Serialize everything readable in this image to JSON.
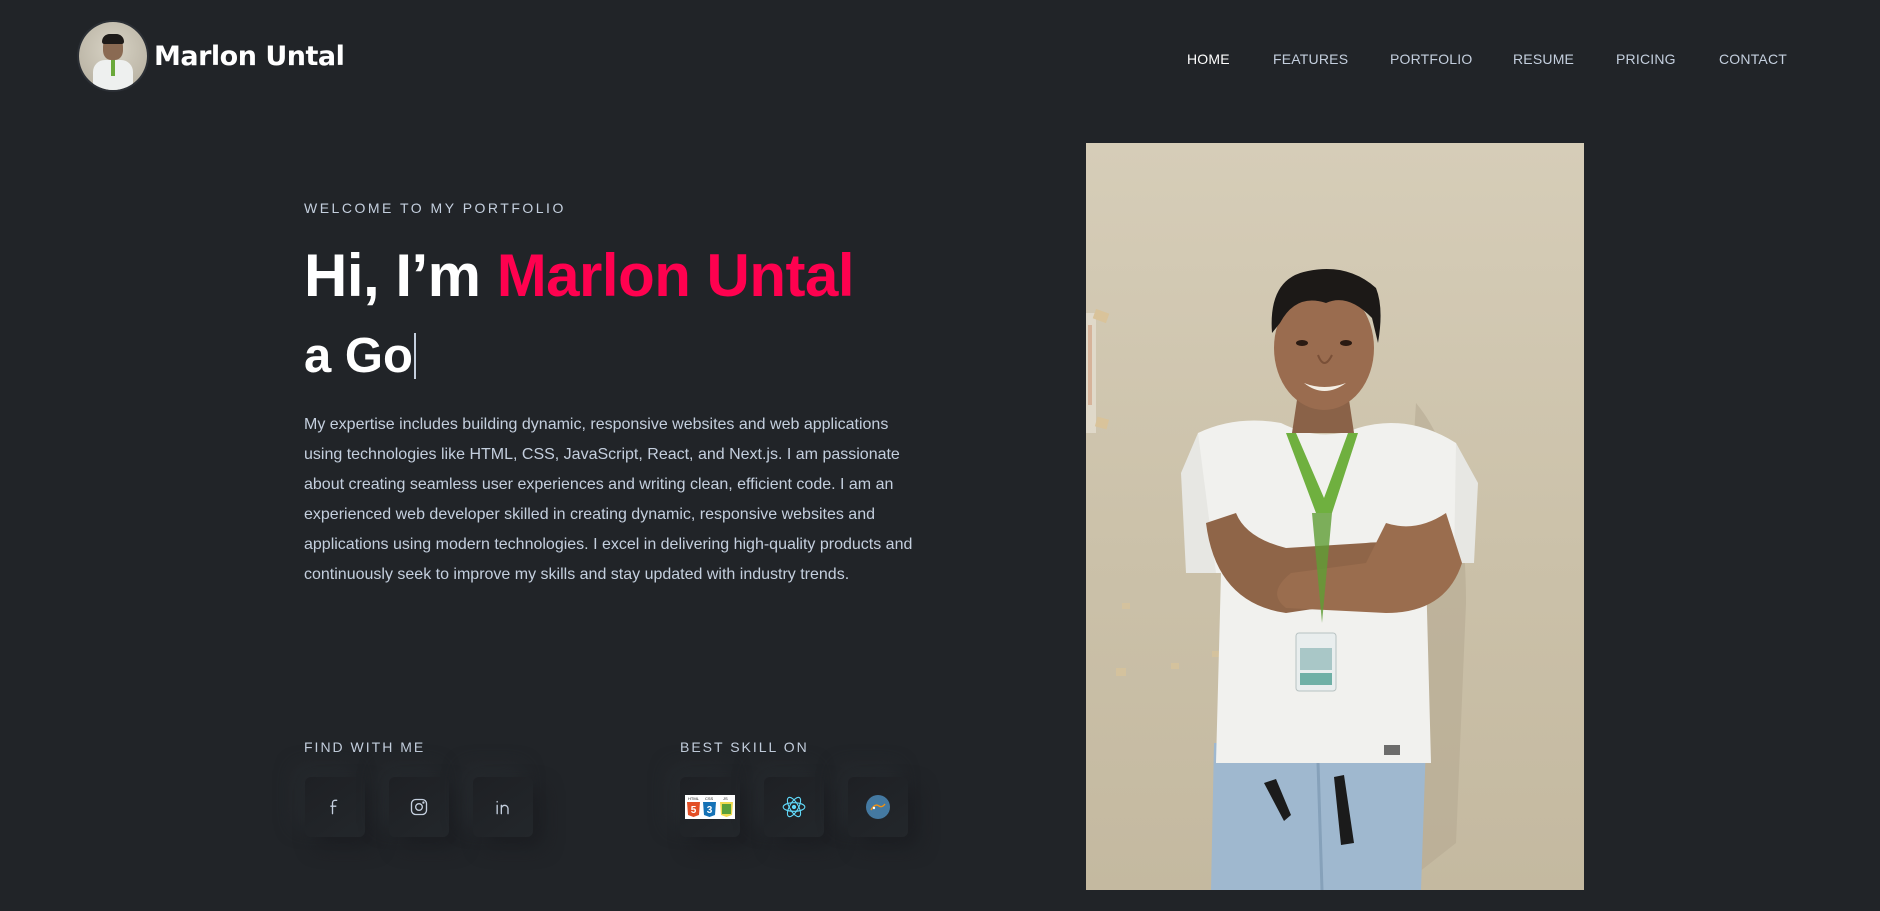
{
  "brand": {
    "name": "Marlon Untal"
  },
  "nav": {
    "items": [
      {
        "label": "HOME",
        "active": true
      },
      {
        "label": "FEATURES",
        "active": false
      },
      {
        "label": "PORTFOLIO",
        "active": false
      },
      {
        "label": "RESUME",
        "active": false
      },
      {
        "label": "PRICING",
        "active": false
      },
      {
        "label": "CONTACT",
        "active": false
      }
    ]
  },
  "hero": {
    "eyebrow": "WELCOME TO MY PORTFOLIO",
    "greeting": "Hi, I’m ",
    "name": "Marlon Untal",
    "typed_text": "a Go",
    "description": "My expertise includes building dynamic, responsive websites and web applications using technologies like HTML, CSS, JavaScript, React, and Next.js. I am passionate about creating seamless user experiences and writing clean, efficient code. I am an experienced web developer skilled in creating dynamic, responsive websites and applications using modern technologies. I excel in delivering high-quality products and continuously seek to improve my skills and stay updated with industry trends."
  },
  "social": {
    "title": "FIND WITH ME",
    "icons": [
      "facebook-icon",
      "instagram-icon",
      "linkedin-icon"
    ]
  },
  "skills": {
    "title": "BEST SKILL ON",
    "icons": [
      "html-css-js-icon",
      "react-icon",
      "mysql-icon"
    ],
    "badge_labels": [
      "HTML",
      "CSS",
      "JS"
    ]
  },
  "colors": {
    "background": "#212428",
    "accent": "#ff014f",
    "text": "#c4cfde",
    "heading": "#ffffff"
  }
}
